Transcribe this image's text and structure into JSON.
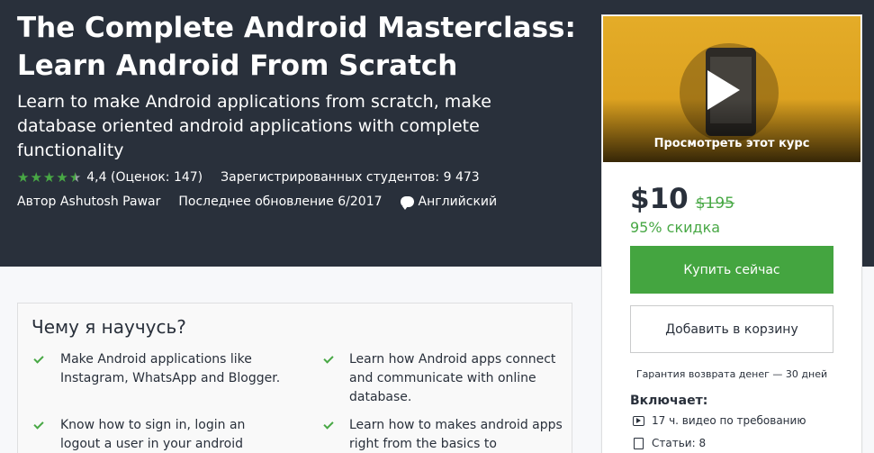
{
  "course": {
    "title": "The Complete Android Masterclass: Learn Android From Scratch",
    "subtitle": "Learn to make Android applications from scratch, make database oriented android applications with complete functionality",
    "rating": 4.4,
    "rating_text": "4,4 (Оценок: 147)",
    "students_text": "Зарегистрированных студентов: 9 473",
    "author_text": "Автор Ashutosh Pawar",
    "updated_text": "Последнее обновление 6/2017",
    "language": "Английский",
    "accent_green": "#48a845",
    "hero_bg": "#29303b"
  },
  "sidebar": {
    "preview_caption": "Просмотреть этот курс",
    "price": "$10",
    "old_price": "$195",
    "discount": "95% скидка",
    "buy_label": "Купить сейчас",
    "cart_label": "Добавить в корзину",
    "guarantee": "Гарантия возврата денег — 30 дней",
    "includes_title": "Включает:",
    "includes": [
      {
        "icon": "video-icon",
        "text": "17 ч. видео по требованию"
      },
      {
        "icon": "document-icon",
        "text": "Статьи: 8"
      }
    ]
  },
  "learn": {
    "title": "Чему я научусь?",
    "items": [
      "Make Android applications like Instagram, WhatsApp and Blogger.",
      "Learn how Android apps connect and communicate with online database.",
      "Know how to sign in, login an logout a user in your android",
      "Learn how to makes android apps right from the basics to"
    ]
  }
}
